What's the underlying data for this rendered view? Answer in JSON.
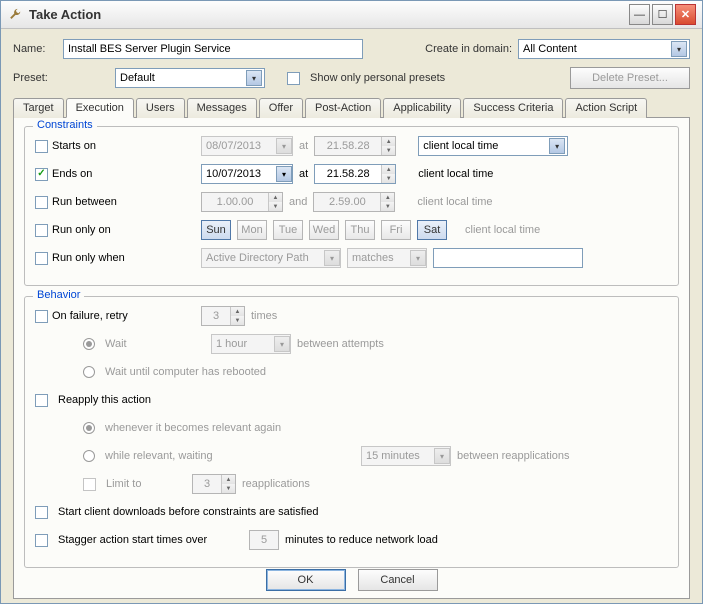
{
  "window": {
    "title": "Take Action"
  },
  "top": {
    "name_label": "Name:",
    "name_value": "Install BES Server Plugin Service",
    "domain_label": "Create in domain:",
    "domain_value": "All Content",
    "preset_label": "Preset:",
    "preset_value": "Default",
    "show_personal_label": "Show only personal presets",
    "delete_preset_label": "Delete Preset..."
  },
  "tabs": [
    "Target",
    "Execution",
    "Users",
    "Messages",
    "Offer",
    "Post-Action",
    "Applicability",
    "Success Criteria",
    "Action Script"
  ],
  "active_tab": "Execution",
  "constraints": {
    "legend": "Constraints",
    "starts_on": "Starts on",
    "starts_date": "08/07/2013",
    "starts_time": "21.58.28",
    "at": "at",
    "timezone_value": "client local time",
    "ends_on": "Ends on",
    "ends_date": "10/07/2013",
    "ends_time": "21.58.28",
    "client_local": "client local time",
    "run_between": "Run between",
    "rb_from": "1.00.00",
    "and": "and",
    "rb_to": "2.59.00",
    "run_only_on": "Run only on",
    "days": [
      "Sun",
      "Mon",
      "Tue",
      "Wed",
      "Thu",
      "Fri",
      "Sat"
    ],
    "run_only_when": "Run only when",
    "row_value": "Active Directory Path",
    "row_op": "matches"
  },
  "behavior": {
    "legend": "Behavior",
    "on_failure": "On failure, retry",
    "retry_times": "3",
    "times": "times",
    "wait": "Wait",
    "wait_dur": "1 hour",
    "between_attempts": "between attempts",
    "wait_reboot": "Wait until computer has rebooted",
    "reapply": "Reapply this action",
    "whenever": "whenever it becomes relevant again",
    "while_relevant": "while relevant, waiting",
    "reapply_dur": "15 minutes",
    "between_reapps": "between reapplications",
    "limit_to": "Limit to",
    "limit_n": "3",
    "reapplications": "reapplications",
    "start_downloads": "Start client downloads before constraints are satisfied",
    "stagger": "Stagger action start times over",
    "stagger_n": "5",
    "stagger_tail": "minutes to reduce network load"
  },
  "footer": {
    "ok": "OK",
    "cancel": "Cancel"
  }
}
